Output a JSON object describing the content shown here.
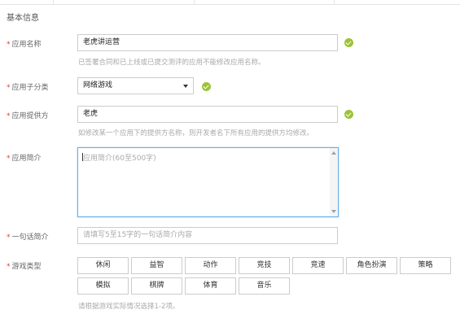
{
  "section_title": "基本信息",
  "required_mark": "*",
  "app_name": {
    "label": "应用名称",
    "value": "老虎讲运营",
    "hint": "已签署合同和已上线或已提交测评的应用不能修改应用名称。"
  },
  "app_subcategory": {
    "label": "应用子分类",
    "value": "网络游戏"
  },
  "app_provider": {
    "label": "应用提供方",
    "value": "老虎",
    "hint": "如修改某一个应用下的提供方名称，则开发者名下所有应用的提供方均修改。"
  },
  "app_intro": {
    "label": "应用简介",
    "placeholder": "应用简介(60至500字)"
  },
  "one_line_intro": {
    "label": "一句话简介",
    "placeholder": "请填写5至15字的一句话简介内容"
  },
  "game_type": {
    "label": "游戏类型",
    "tags": [
      "休闲",
      "益智",
      "动作",
      "竞技",
      "竞速",
      "角色扮演",
      "策略",
      "模拟",
      "棋牌",
      "体育",
      "音乐"
    ],
    "hint": "请根据游戏实际情况选择1-2项。"
  },
  "colors": {
    "valid": "#9cc33a",
    "required": "#e4393c",
    "focus_border": "#66afe9"
  },
  "icons": {
    "valid": "check-circle-icon",
    "dropdown": "caret-down-icon"
  }
}
